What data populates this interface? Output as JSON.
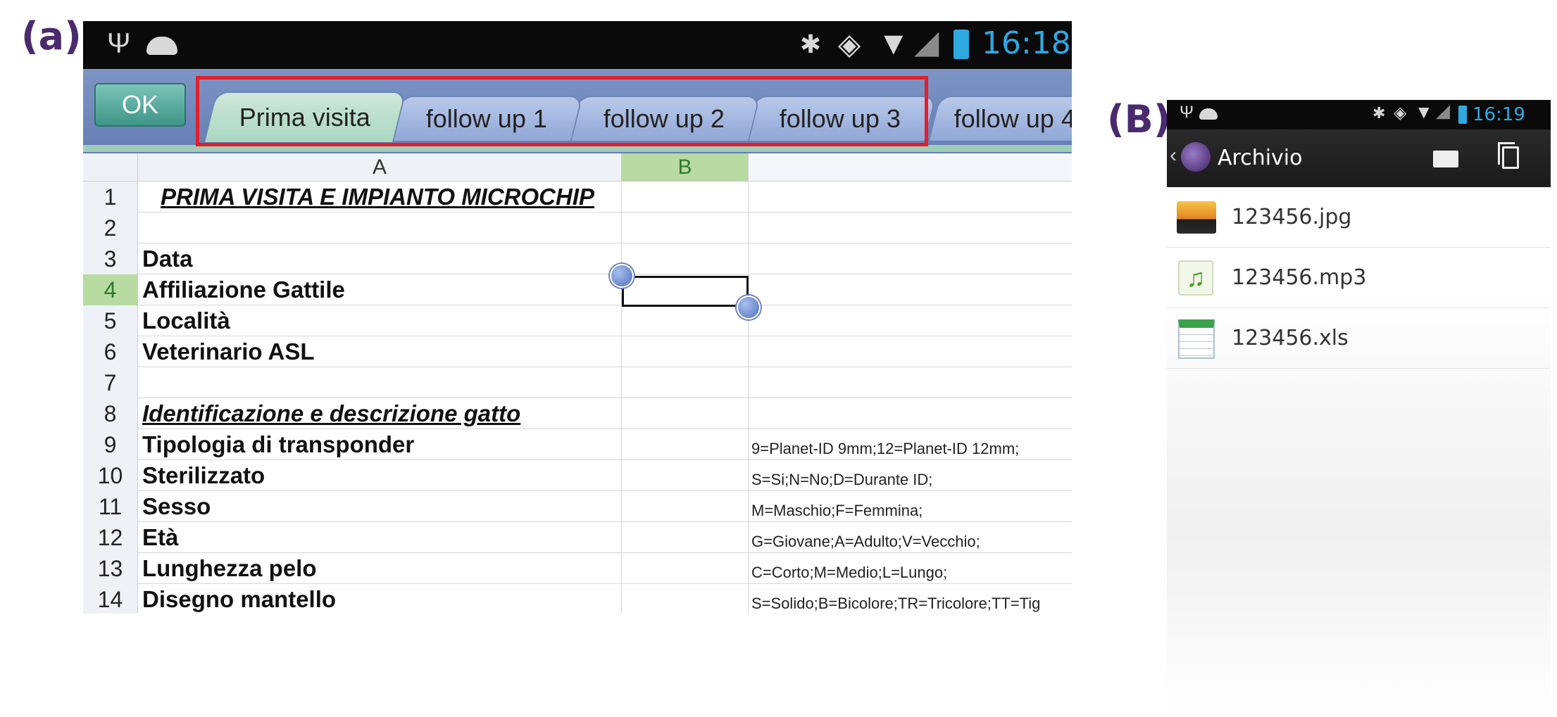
{
  "labels": {
    "a": "(a)",
    "b": "(B)"
  },
  "panelA": {
    "status": {
      "usb": "Ψ",
      "android": "◐",
      "bt": "✱",
      "vibrate": "◈",
      "wifi": "▼",
      "signal": "◢",
      "battery": "⚡",
      "time": "16:18"
    },
    "ok": "OK",
    "tabs": [
      "Prima visita",
      "follow up 1",
      "follow up 2",
      "follow up 3",
      "follow up 4"
    ],
    "columns": [
      "A",
      "B"
    ],
    "rows": [
      {
        "n": "1",
        "a": "PRIMA VISITA E IMPIANTO MICROCHIP",
        "c": ""
      },
      {
        "n": "2",
        "a": "",
        "c": ""
      },
      {
        "n": "3",
        "a": "Data",
        "c": ""
      },
      {
        "n": "4",
        "a": "Affiliazione Gattile",
        "c": ""
      },
      {
        "n": "5",
        "a": "Località",
        "c": ""
      },
      {
        "n": "6",
        "a": "Veterinario ASL",
        "c": ""
      },
      {
        "n": "7",
        "a": "",
        "c": ""
      },
      {
        "n": "8",
        "a": "Identificazione e descrizione gatto",
        "c": ""
      },
      {
        "n": "9",
        "a": "Tipologia di transponder",
        "c": "9=Planet-ID 9mm;12=Planet-ID 12mm;"
      },
      {
        "n": "10",
        "a": "Sterilizzato",
        "c": "S=Si;N=No;D=Durante ID;"
      },
      {
        "n": "11",
        "a": "Sesso",
        "c": "M=Maschio;F=Femmina;"
      },
      {
        "n": "12",
        "a": "Età",
        "c": "G=Giovane;A=Adulto;V=Vecchio;"
      },
      {
        "n": "13",
        "a": "Lunghezza pelo",
        "c": "C=Corto;M=Medio;L=Lungo;"
      },
      {
        "n": "14",
        "a": "Disegno mantello",
        "c": "S=Solido;B=Bicolore;TR=Tricolore;TT=Tig"
      }
    ]
  },
  "panelB": {
    "status": {
      "time": "16:19"
    },
    "title": "Archivio",
    "files": [
      "123456.jpg",
      "123456.mp3",
      "123456.xls"
    ]
  }
}
